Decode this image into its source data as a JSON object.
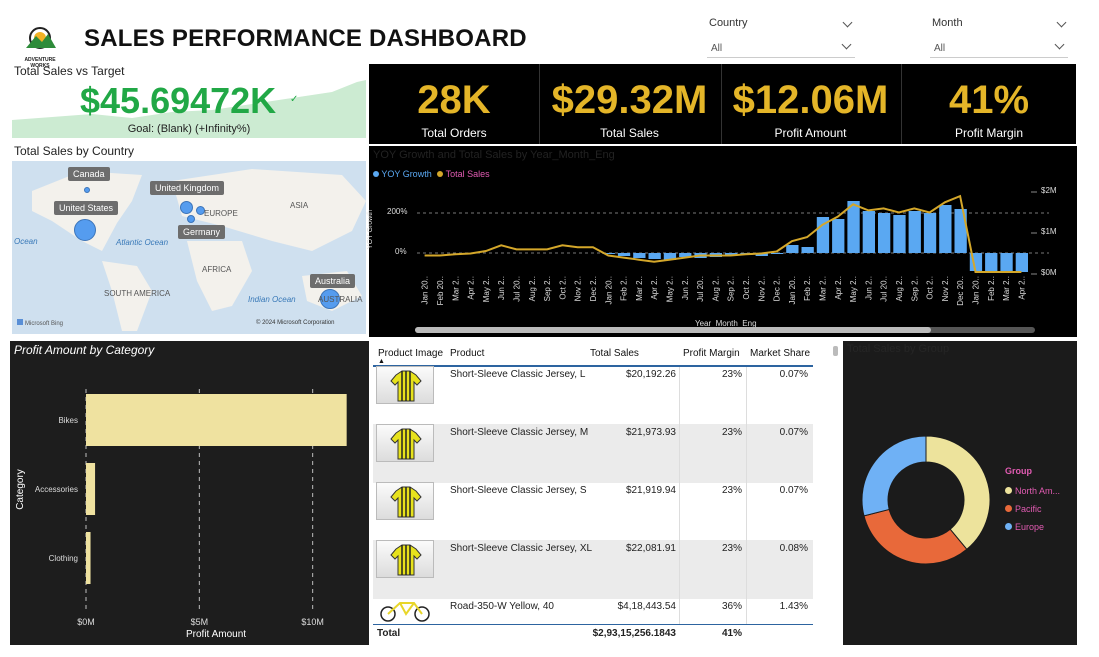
{
  "header": {
    "logo_text": "ADVENTURE WORKS",
    "title": "SALES PERFORMANCE DASHBOARD"
  },
  "slicers": [
    {
      "label": "Country",
      "value": "All"
    },
    {
      "label": "Month",
      "value": "All"
    }
  ],
  "kpi_gauge": {
    "title": "Total Sales vs Target",
    "value": "$45.69472K",
    "goal": "Goal: (Blank) (+Infinity%)"
  },
  "kpis": [
    {
      "value": "28K",
      "label": "Total Orders"
    },
    {
      "value": "$29.32M",
      "label": "Total Sales"
    },
    {
      "value": "$12.06M",
      "label": "Profit Amount"
    },
    {
      "value": "41%",
      "label": "Profit Margin"
    }
  ],
  "map": {
    "title": "Total Sales by Country",
    "labels": [
      "Canada",
      "United Kingdom",
      "United States",
      "Germany",
      "Australia"
    ],
    "geo": [
      "EUROPE",
      "ASIA",
      "AFRICA",
      "SOUTH AMERICA",
      "AUSTRALIA"
    ],
    "oceans": [
      "Ocean",
      "Atlantic Ocean",
      "Indian Ocean"
    ],
    "attribution": "Microsoft Bing",
    "copyright": "© 2024 Microsoft Corporation"
  },
  "yoy_chart": {
    "title": "YOY Growth and Total Sales by Year_Month_Eng",
    "legend": [
      "YOY Growth",
      "Total Sales"
    ],
    "ylabel": "YOY Growth",
    "xlabel": "Year_Month_Eng",
    "left_ticks": [
      "200%",
      "0%"
    ],
    "right_ticks": [
      "$2M",
      "$1M",
      "$0M"
    ],
    "colors": {
      "bar": "#5aa8f2",
      "line": "#d4a72a"
    }
  },
  "bar_chart": {
    "title": "Profit Amount by Category",
    "ylabel": "Category",
    "xlabel": "Profit Amount",
    "ticks": [
      "$0M",
      "$5M",
      "$10M"
    ],
    "color": "#efe2a0"
  },
  "table": {
    "headers": [
      "Product Image",
      "Product",
      "Total Sales",
      "Profit Margin",
      "Market Share"
    ],
    "rows": [
      {
        "product": "Short-Sleeve Classic Jersey, L",
        "sales": "$20,192.26",
        "margin": "23%",
        "share": "0.07%"
      },
      {
        "product": "Short-Sleeve Classic Jersey, M",
        "sales": "$21,973.93",
        "margin": "23%",
        "share": "0.07%"
      },
      {
        "product": "Short-Sleeve Classic Jersey, S",
        "sales": "$21,919.94",
        "margin": "23%",
        "share": "0.07%"
      },
      {
        "product": "Short-Sleeve Classic Jersey, XL",
        "sales": "$22,081.91",
        "margin": "23%",
        "share": "0.08%"
      },
      {
        "product": "Road-350-W Yellow, 40",
        "sales": "$4,18,443.54",
        "margin": "36%",
        "share": "1.43%"
      }
    ],
    "total": {
      "label": "Total",
      "sales": "$2,93,15,256.1843",
      "margin": "41%"
    }
  },
  "donut": {
    "title": "Total Sales by Group",
    "legend_title": "Group",
    "legend": [
      "North Am...",
      "Pacific",
      "Europe"
    ],
    "colors": [
      "#ede39c",
      "#e8693a",
      "#6fb1f5"
    ]
  },
  "chart_data": [
    {
      "type": "bar",
      "title": "Profit Amount by Category",
      "categories": [
        "Bikes",
        "Accessories",
        "Clothing"
      ],
      "values": [
        11.5,
        0.4,
        0.2
      ],
      "xlabel": "Profit Amount",
      "ylabel": "Category",
      "xlim": [
        0,
        12
      ],
      "unit": "$M"
    },
    {
      "type": "line",
      "title": "YOY Growth and Total Sales by Year_Month_Eng",
      "x": [
        "Jan 20..",
        "Feb 20..",
        "Mar 2..",
        "Apr 2..",
        "May 2..",
        "Jun 2..",
        "Jul 20..",
        "Aug 2..",
        "Sep 2..",
        "Oct 2..",
        "Nov 2..",
        "Dec 2..",
        "Jan 20..",
        "Feb 2..",
        "Mar 2..",
        "Apr 2..",
        "May 2..",
        "Jun 2..",
        "Jul 20..",
        "Aug 2..",
        "Sep 2..",
        "Oct 2..",
        "Nov 2..",
        "Dec 2..",
        "Jan 20..",
        "Feb 2..",
        "Mar 2..",
        "Apr 2..",
        "May 2..",
        "Jun 2..",
        "Jul 20..",
        "Aug 2..",
        "Sep 2..",
        "Oct 2..",
        "Nov 2..",
        "Dec 20..",
        "Jan 20..",
        "Feb 2..",
        "Mar 2..",
        "Apr 2.."
      ],
      "series": [
        {
          "name": "YOY Growth",
          "values": [
            0,
            0,
            0,
            0,
            0,
            0,
            0,
            0,
            0,
            0,
            0,
            0,
            -5,
            -15,
            -25,
            -30,
            -35,
            -20,
            -25,
            -20,
            -15,
            -10,
            -15,
            -5,
            40,
            30,
            180,
            170,
            260,
            210,
            200,
            190,
            210,
            200,
            240,
            220,
            -90,
            -95,
            -90,
            -95
          ]
        },
        {
          "name": "Total Sales",
          "values": [
            0.45,
            0.45,
            0.48,
            0.5,
            0.56,
            0.7,
            0.6,
            0.6,
            0.6,
            0.7,
            0.65,
            0.65,
            0.45,
            0.4,
            0.35,
            0.3,
            0.35,
            0.4,
            0.45,
            0.45,
            0.45,
            0.48,
            0.5,
            0.55,
            0.8,
            0.9,
            1.2,
            1.4,
            1.7,
            1.55,
            1.6,
            1.5,
            1.6,
            1.5,
            1.75,
            1.9,
            0.05,
            0.05,
            0.05,
            0.05
          ]
        }
      ],
      "ylabel": "YOY Growth",
      "xlabel": "Year_Month_Eng"
    },
    {
      "type": "pie",
      "title": "Total Sales by Group",
      "categories": [
        "North Am...",
        "Pacific",
        "Europe"
      ],
      "values": [
        39,
        32,
        29
      ]
    }
  ]
}
